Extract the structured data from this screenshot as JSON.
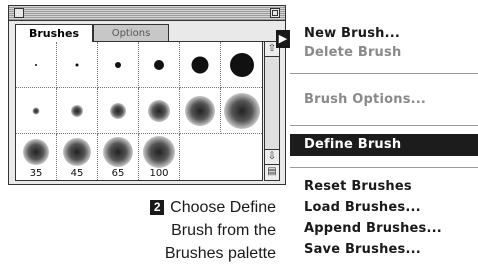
{
  "palette": {
    "tabs": {
      "brushes": "Brushes",
      "options": "Options"
    },
    "brush_size_labels": [
      "35",
      "45",
      "65",
      "100"
    ]
  },
  "menu": {
    "items": [
      {
        "label": "New Brush...",
        "enabled": true
      },
      {
        "label": "Delete Brush",
        "enabled": false
      },
      {
        "label": "Brush Options...",
        "enabled": false
      },
      {
        "label": "Define Brush",
        "enabled": true,
        "highlighted": true
      },
      {
        "label": "Reset Brushes",
        "enabled": true
      },
      {
        "label": "Load Brushes...",
        "enabled": true
      },
      {
        "label": "Append Brushes...",
        "enabled": true
      },
      {
        "label": "Save Brushes...",
        "enabled": true
      }
    ]
  },
  "caption": {
    "step_number": "2",
    "line1": "Choose Define",
    "line2": "Brush from the",
    "line3": "Brushes palette"
  }
}
